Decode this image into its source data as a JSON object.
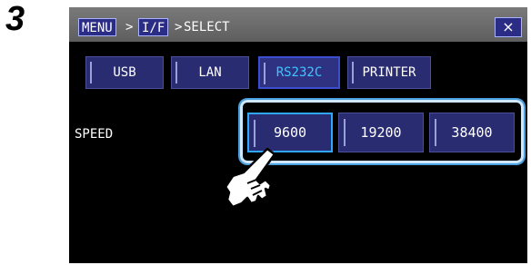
{
  "step_number": "3",
  "breadcrumb": {
    "menu": "MENU",
    "sep1": ">",
    "interface": "I/F",
    "sep2": ">",
    "current": "SELECT"
  },
  "close_label": "×",
  "tabs": [
    {
      "label": "USB"
    },
    {
      "label": "LAN"
    },
    {
      "label": "RS232C",
      "selected": true
    },
    {
      "label": "PRINTER"
    }
  ],
  "speed": {
    "label": "SPEED",
    "options": [
      {
        "label": "9600",
        "selected": true
      },
      {
        "label": "19200"
      },
      {
        "label": "38400"
      }
    ]
  },
  "colors": {
    "accent": "#3fc6ff",
    "button_bg": "#2a2c72",
    "highlight": "#cfe6ff"
  }
}
